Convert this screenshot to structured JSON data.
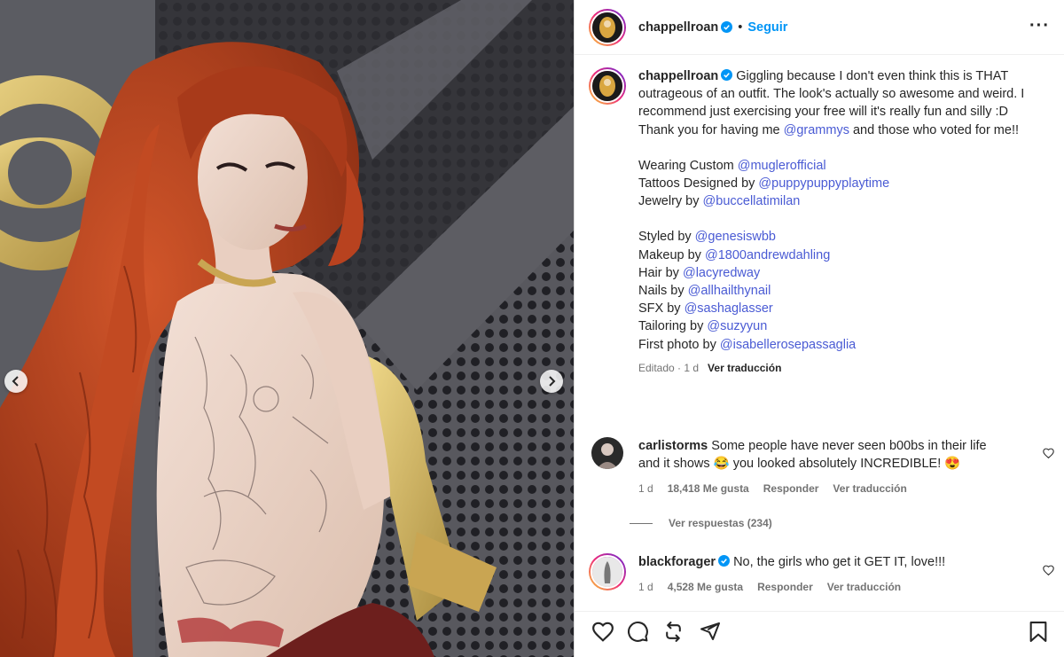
{
  "post": {
    "author": "chappellroan",
    "follow_label": "Seguir",
    "dot": "•",
    "more_label": "···"
  },
  "caption": {
    "author": "chappellroan",
    "line1": "Giggling because I don't even think this is THAT outrageous of an outfit. The look's actually so awesome and weird. I recommend just exercising your free will it's really fun and silly :D",
    "thanks_prefix": "Thank you for having me ",
    "thanks_mention": "@grammys",
    "thanks_suffix": " and those who voted for me!!",
    "credits1": [
      {
        "label": "Wearing Custom ",
        "mention": "@muglerofficial"
      },
      {
        "label": "Tattoos Designed by ",
        "mention": "@puppypuppyplaytime"
      },
      {
        "label": "Jewelry by ",
        "mention": "@buccellatimilan"
      }
    ],
    "credits2": [
      {
        "label": "Styled by ",
        "mention": "@genesiswbb"
      },
      {
        "label": "Makeup by ",
        "mention": "@1800andrewdahling"
      },
      {
        "label": "Hair by ",
        "mention": "@lacyredway"
      },
      {
        "label": "Nails by ",
        "mention": "@allhailthynail"
      },
      {
        "label": "SFX by ",
        "mention": "@sashaglasser"
      },
      {
        "label": "Tailoring by ",
        "mention": "@suzyyun"
      },
      {
        "label": "First photo by ",
        "mention": "@isabellerosepassaglia"
      }
    ],
    "edited": "Editado · 1 d",
    "translate": "Ver traducción"
  },
  "comments": [
    {
      "user": "carlistorms",
      "text": "Some people have never seen b00bs in their life and it shows 😂 you looked absolutely INCREDIBLE! 😍",
      "time": "1 d",
      "likes": "18,418 Me gusta",
      "reply": "Responder",
      "translate": "Ver traducción",
      "verified": false
    },
    {
      "user": "blackforager",
      "text": "No, the girls who get it GET IT, love!!!",
      "time": "1 d",
      "likes": "4,528 Me gusta",
      "reply": "Responder",
      "translate": "Ver traducción",
      "verified": true
    }
  ],
  "replies_label": "Ver respuestas (234)",
  "colors": {
    "accent": "#0095f6",
    "mention": "#4a5bd4",
    "verified": "#0095f6",
    "hair": "#b8421f",
    "background": "#3c3c40"
  },
  "icons": [
    "heart-icon",
    "comment-icon",
    "repost-icon",
    "share-icon",
    "bookmark-icon",
    "verified-icon",
    "chevron-left-icon",
    "chevron-right-icon",
    "more-icon"
  ]
}
